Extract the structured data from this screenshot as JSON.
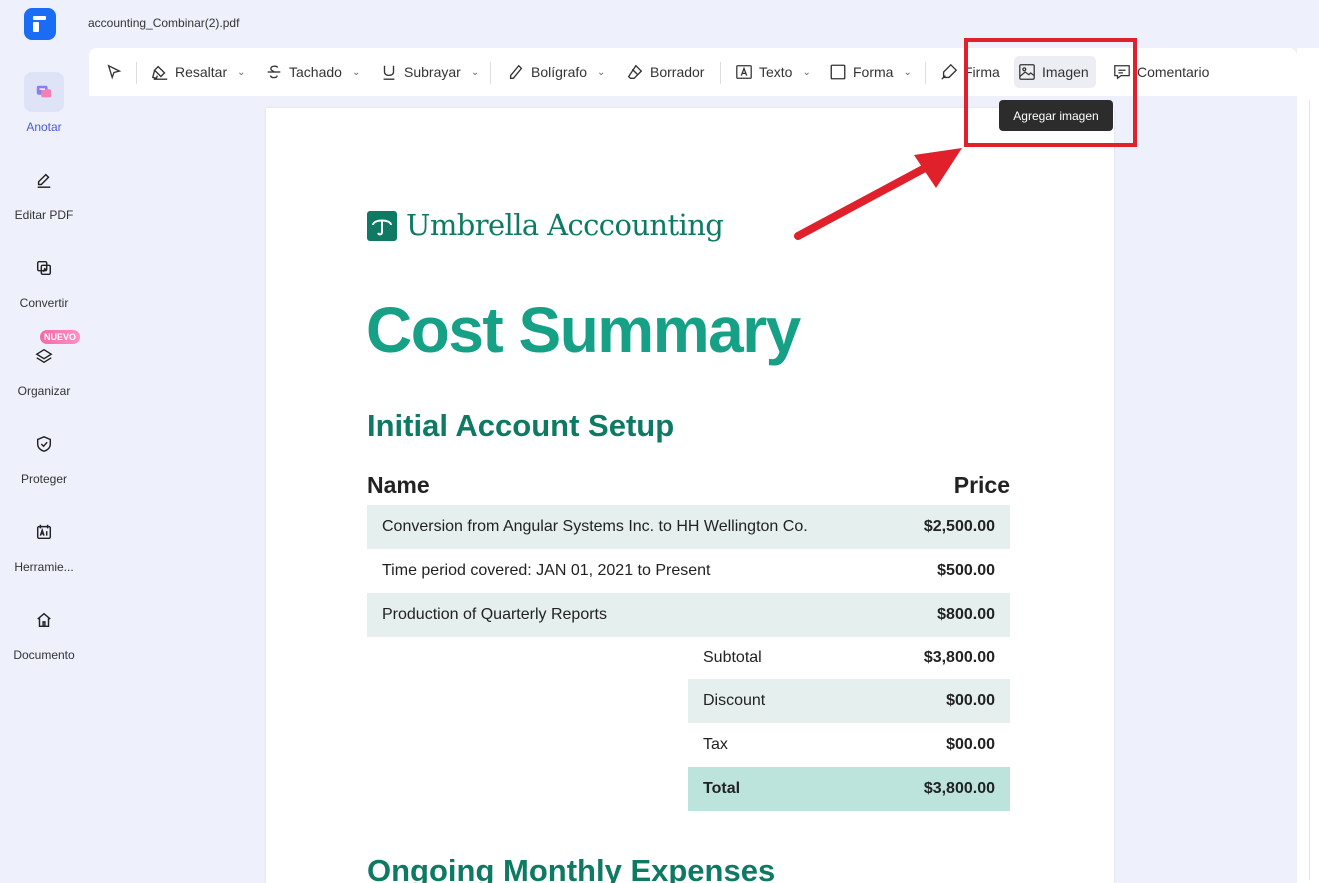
{
  "window": {
    "file_name": "accounting_Combinar(2).pdf"
  },
  "sidebar": {
    "items": [
      {
        "label": "Anotar",
        "icon": "annotate-icon",
        "active": true
      },
      {
        "label": "Editar PDF",
        "icon": "edit-pdf-icon"
      },
      {
        "label": "Convertir",
        "icon": "convert-icon"
      },
      {
        "label": "Organizar",
        "icon": "organize-icon",
        "badge": "NUEVO"
      },
      {
        "label": "Proteger",
        "icon": "protect-icon"
      },
      {
        "label": "Herramie...",
        "icon": "tools-icon"
      },
      {
        "label": "Documento",
        "icon": "home-icon"
      }
    ]
  },
  "toolbar": {
    "select_icon": "cursor-icon",
    "highlight": "Resaltar",
    "strikethrough": "Tachado",
    "underline": "Subrayar",
    "pen": "Bolígrafo",
    "eraser": "Borrador",
    "text": "Texto",
    "shape": "Forma",
    "signature": "Firma",
    "image": "Imagen",
    "comment": "Comentario"
  },
  "tooltip": {
    "text": "Agregar imagen"
  },
  "document": {
    "brand": "Umbrella Acccounting",
    "title": "Cost Summary",
    "section1": "Initial Account Setup",
    "col_name": "Name",
    "col_price": "Price",
    "rows": [
      {
        "name": "Conversion from Angular Systems Inc. to HH Wellington Co.",
        "price": "$2,500.00"
      },
      {
        "name": "Time period covered: JAN 01, 2021 to Present",
        "price": "$500.00"
      },
      {
        "name": "Production of Quarterly Reports",
        "price": "$800.00"
      }
    ],
    "summary": [
      {
        "label": "Subtotal",
        "value": "$3,800.00"
      },
      {
        "label": "Discount",
        "value": "$00.00"
      },
      {
        "label": "Tax",
        "value": "$00.00"
      },
      {
        "label": "Total",
        "value": "$3,800.00"
      }
    ],
    "section2": "Ongoing Monthly Expenses"
  },
  "colors": {
    "accent": "#4a5bd8",
    "brand_green": "#0e7a63",
    "title_green": "#16a085",
    "highlight_red": "#e0202a"
  }
}
